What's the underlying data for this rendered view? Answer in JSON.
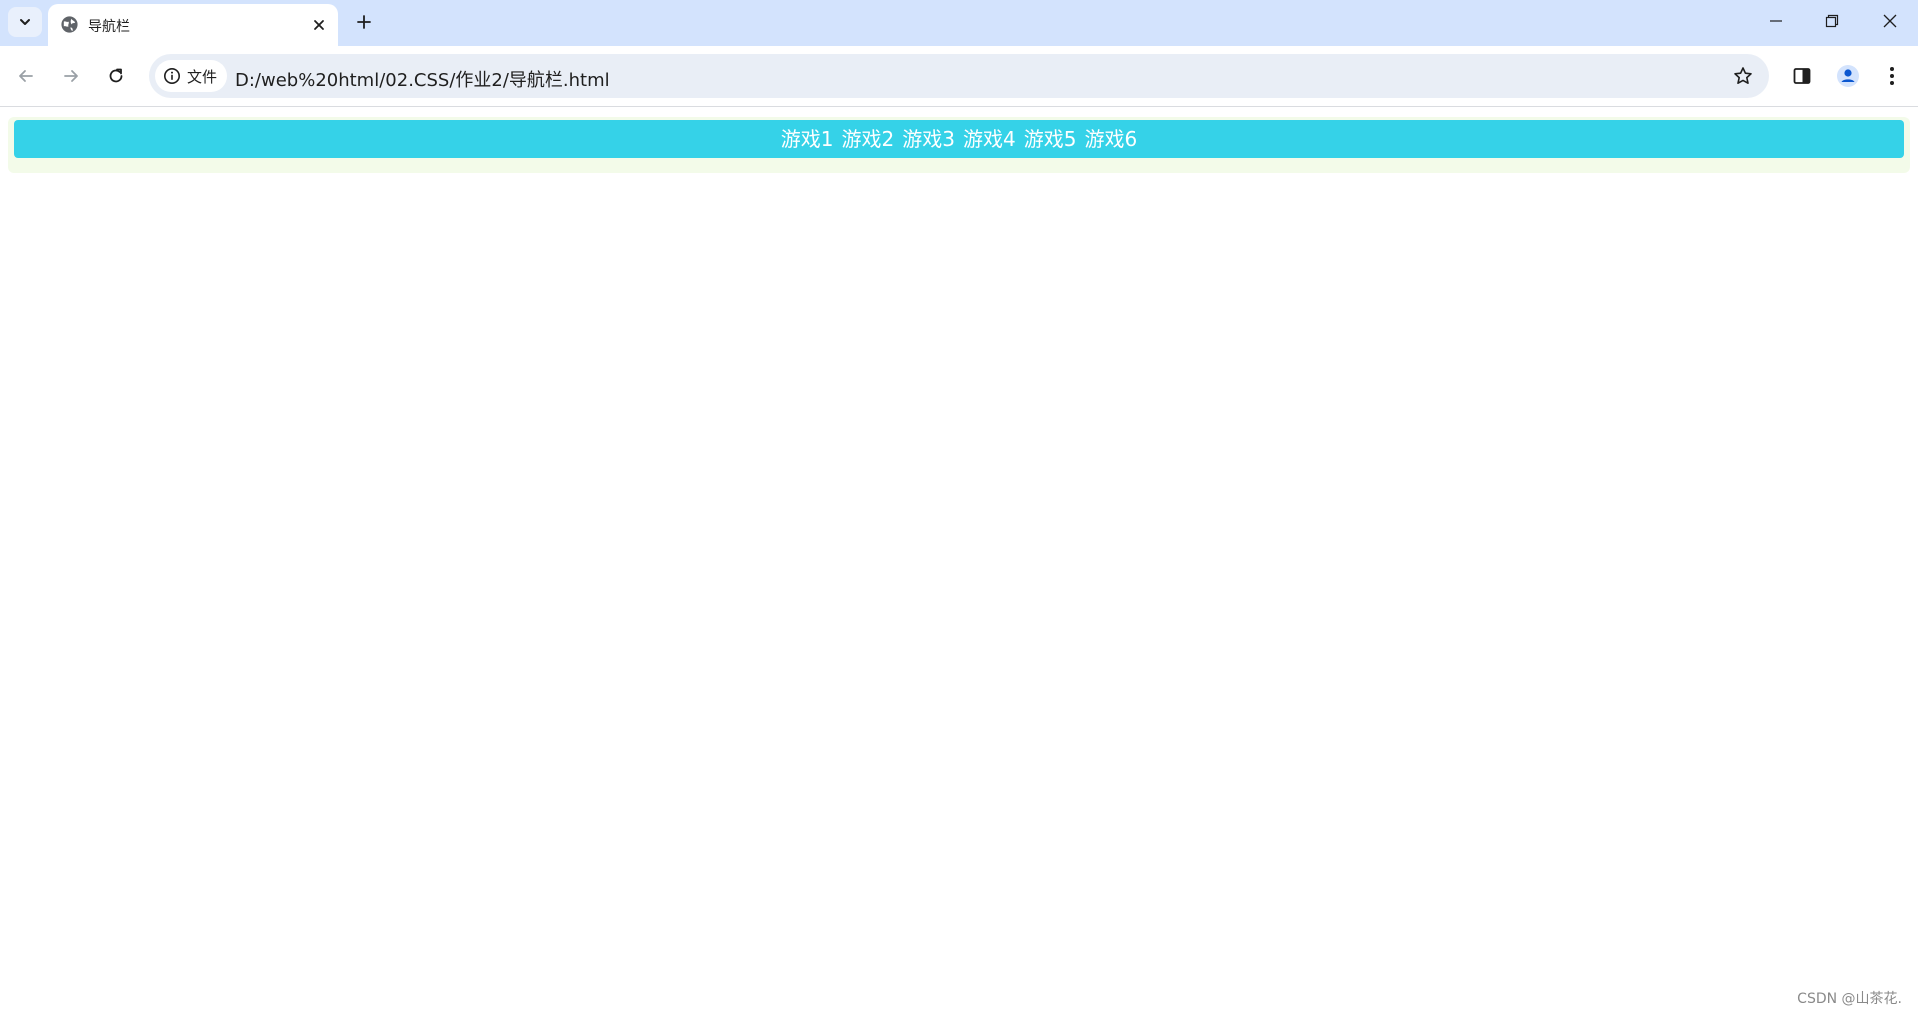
{
  "browser": {
    "tab": {
      "title": "导航栏",
      "favicon": "globe-icon"
    },
    "address_bar": {
      "site_chip_label": "文件",
      "url": "D:/web%20html/02.CSS/作业2/导航栏.html"
    }
  },
  "page": {
    "nav_items": [
      "游戏1",
      "游戏2",
      "游戏3",
      "游戏4",
      "游戏5",
      "游戏6"
    ],
    "nav_bar_color": "#35d2e8",
    "nav_outer_color": "#f3fbe9"
  },
  "watermark": "CSDN @山茶花."
}
